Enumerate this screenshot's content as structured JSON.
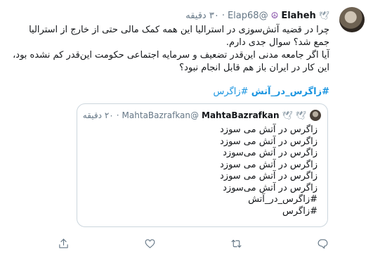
{
  "tweet": {
    "display_name": "Elaheh",
    "handle": "@Elap68",
    "separator": "·",
    "time": "۳۰ دقیقه",
    "text_lines": [
      "چرا در قضیه آتش‌سوزی در استرالیا این همه کمک مالی حتی از خارج از استرالیا",
      "جمع شد؟ سوال جدی دارم.",
      "آیا اگر جامعه مدنی این‌قدر تضعیف و سرمایه اجتماعی حکومت این‌قدر کم نشده بود،",
      "این کار در ایران باز هم قابل انجام نبود؟"
    ],
    "hashtags": [
      "#زاگرس_در_آتش",
      "#زاگرس"
    ]
  },
  "quote": {
    "display_name": "MahtaBazrafkan",
    "handle": "@MahtaBazrafkan",
    "separator": "·",
    "time": "۲۰ دقیقه",
    "lines": [
      "زاگرس در آتش می سوزد",
      "زاگرس در آتش می سوزد",
      "زاگرس در آتش می‌سوزد",
      "زاگرس در آتش می سوزد",
      "زاگرس در آتش می سوزد",
      "زاگرس در آتش می‌سوزد",
      "#زاگرس_در_آتش",
      "#زاگرس"
    ]
  },
  "icons": [
    "peace-icon",
    "dove-icon",
    "reply-icon",
    "retweet-icon",
    "like-icon",
    "share-icon"
  ],
  "colors": {
    "link": "#1b95e0",
    "muted": "#657786",
    "border": "#ccd6dd",
    "text": "#14171a"
  }
}
